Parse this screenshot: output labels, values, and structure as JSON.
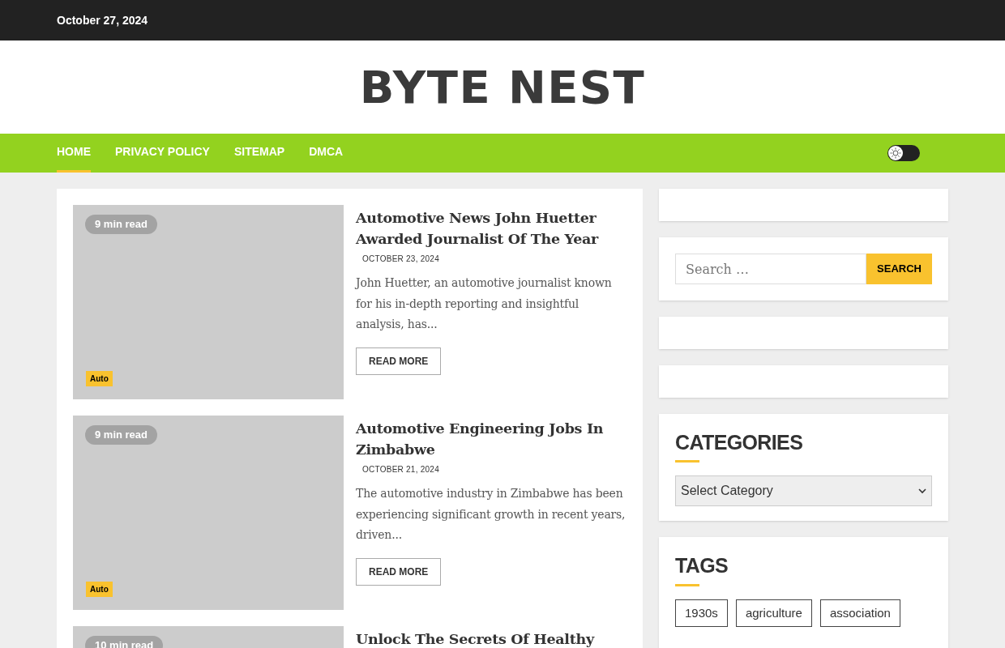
{
  "top_bar": {
    "date": "October 27, 2024"
  },
  "site_title": "BYTE NEST",
  "nav": {
    "items": [
      {
        "label": "HOME",
        "selected": true
      },
      {
        "label": "PRIVACY POLICY",
        "selected": false
      },
      {
        "label": "SITEMAP",
        "selected": false
      },
      {
        "label": "DMCA",
        "selected": false
      }
    ],
    "theme_toggle": {
      "on": false
    }
  },
  "articles": [
    {
      "read_time": "9 min read",
      "category": "Auto",
      "title": "Automotive News John Huetter Awarded Journalist Of The Year",
      "date": "OCTOBER 23, 2024",
      "excerpt": "John Huetter, an automotive journalist known for his in-depth reporting and insightful analysis, has...",
      "button": "READ MORE"
    },
    {
      "read_time": "9 min read",
      "category": "Auto",
      "title": "Automotive Engineering Jobs In Zimbabwe",
      "date": "OCTOBER 21, 2024",
      "excerpt": "The automotive industry in Zimbabwe has been experiencing significant growth in recent years, driven...",
      "button": "READ MORE"
    },
    {
      "read_time": "10 min read",
      "title": "Unlock The Secrets Of Healthy"
    }
  ],
  "sidebar": {
    "search": {
      "placeholder": "Search …",
      "button": "SEARCH"
    },
    "categories": {
      "heading": "CATEGORIES",
      "select": "Select Category"
    },
    "tags": {
      "heading": "TAGS",
      "items": [
        "1930s",
        "agriculture",
        "association"
      ]
    }
  }
}
